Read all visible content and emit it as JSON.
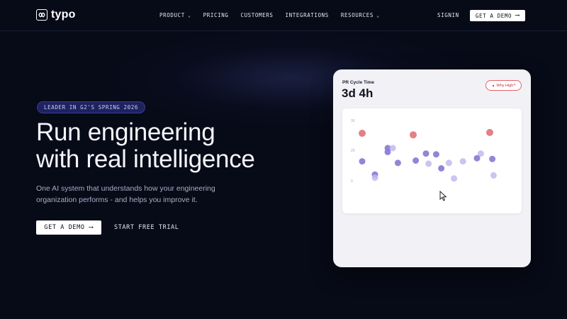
{
  "nav": {
    "logo_text": "typo",
    "menu": [
      {
        "label": "PRODUCT",
        "has_dropdown": true
      },
      {
        "label": "PRICING",
        "has_dropdown": false
      },
      {
        "label": "CUSTOMERS",
        "has_dropdown": false
      },
      {
        "label": "INTEGRATIONS",
        "has_dropdown": false
      },
      {
        "label": "RESOURCES",
        "has_dropdown": true
      }
    ],
    "signin_label": "SIGNIN",
    "demo_label": "GET A DEMO"
  },
  "hero": {
    "badge": "LEADER IN G2'S SPRING 2026",
    "headline_line1": "Run engineering",
    "headline_line2": "with real intelligence",
    "subtext": "One AI system that understands how your engineering organization performs - and helps you improve it.",
    "demo_label": "GET A DEMO",
    "trial_label": "START FREE TRIAL"
  },
  "card": {
    "label": "PR Cycle Time",
    "value": "3d 4h",
    "why_label": "Why High?",
    "colors": {
      "high": "#e07a80",
      "normal": "#8a7fd6",
      "light": "#c4b9ef"
    }
  },
  "chart_data": {
    "type": "scatter",
    "y_ticks": [
      "30",
      "20",
      "0"
    ],
    "points": [
      {
        "x": 1,
        "y": 30,
        "kind": "high"
      },
      {
        "x": 5,
        "y": 29,
        "kind": "high"
      },
      {
        "x": 11,
        "y": 30.5,
        "kind": "high"
      },
      {
        "x": 3,
        "y": 20.5,
        "kind": "normal"
      },
      {
        "x": 3.4,
        "y": 20.5,
        "kind": "light"
      },
      {
        "x": 3,
        "y": 18,
        "kind": "normal"
      },
      {
        "x": 6,
        "y": 17,
        "kind": "normal"
      },
      {
        "x": 6.8,
        "y": 16.5,
        "kind": "normal"
      },
      {
        "x": 10.3,
        "y": 17,
        "kind": "light"
      },
      {
        "x": 1,
        "y": 12,
        "kind": "normal"
      },
      {
        "x": 3.8,
        "y": 11,
        "kind": "normal"
      },
      {
        "x": 5.2,
        "y": 12.5,
        "kind": "normal"
      },
      {
        "x": 6.2,
        "y": 10.5,
        "kind": "light"
      },
      {
        "x": 7.8,
        "y": 11,
        "kind": "light"
      },
      {
        "x": 8.9,
        "y": 12,
        "kind": "light"
      },
      {
        "x": 10,
        "y": 14,
        "kind": "normal"
      },
      {
        "x": 11.2,
        "y": 13.5,
        "kind": "normal"
      },
      {
        "x": 7.2,
        "y": 7.5,
        "kind": "normal"
      },
      {
        "x": 2,
        "y": 3.5,
        "kind": "normal"
      },
      {
        "x": 2,
        "y": 1.5,
        "kind": "light"
      },
      {
        "x": 8.2,
        "y": 1,
        "kind": "light"
      },
      {
        "x": 11.3,
        "y": 3,
        "kind": "light"
      }
    ]
  }
}
